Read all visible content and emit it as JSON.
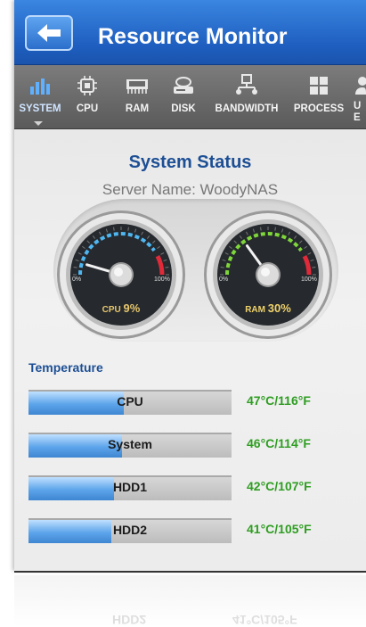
{
  "header": {
    "title": "Resource Monitor",
    "back_icon": "back-arrow-icon"
  },
  "tabs": [
    {
      "label": "SYSTEM",
      "icon": "bar-chart-icon",
      "active": true
    },
    {
      "label": "CPU",
      "icon": "chip-icon",
      "active": false
    },
    {
      "label": "RAM",
      "icon": "ram-icon",
      "active": false
    },
    {
      "label": "DISK",
      "icon": "disk-icon",
      "active": false
    },
    {
      "label": "BANDWIDTH",
      "icon": "network-icon",
      "active": false
    },
    {
      "label": "PROCESS",
      "icon": "process-grid-icon",
      "active": false
    },
    {
      "label": "U\nE",
      "icon": "user-icon",
      "active": false
    }
  ],
  "system_status": {
    "title": "System Status",
    "server_name": "Server Name: WoodyNAS"
  },
  "gauges": [
    {
      "name": "CPU",
      "value_text": "9%",
      "value": 9,
      "min_label": "0%",
      "max_label": "100%",
      "accent": "#4fb6f0"
    },
    {
      "name": "RAM",
      "value_text": "30%",
      "value": 30,
      "min_label": "0%",
      "max_label": "100%",
      "accent": "#7ed63a"
    }
  ],
  "temperature": {
    "heading": "Temperature",
    "rows": [
      {
        "name": "CPU",
        "value": "47°C/116°F",
        "fill": 0.47
      },
      {
        "name": "System",
        "value": "46°C/114°F",
        "fill": 0.46
      },
      {
        "name": "HDD1",
        "value": "42°C/107°F",
        "fill": 0.42
      },
      {
        "name": "HDD2",
        "value": "41°C/105°F",
        "fill": 0.41
      }
    ]
  },
  "colors": {
    "header_blue": "#1f5fc0",
    "title_blue": "#1d4f95",
    "temp_green": "#2f9d22",
    "danger_red": "#e02a3a"
  }
}
